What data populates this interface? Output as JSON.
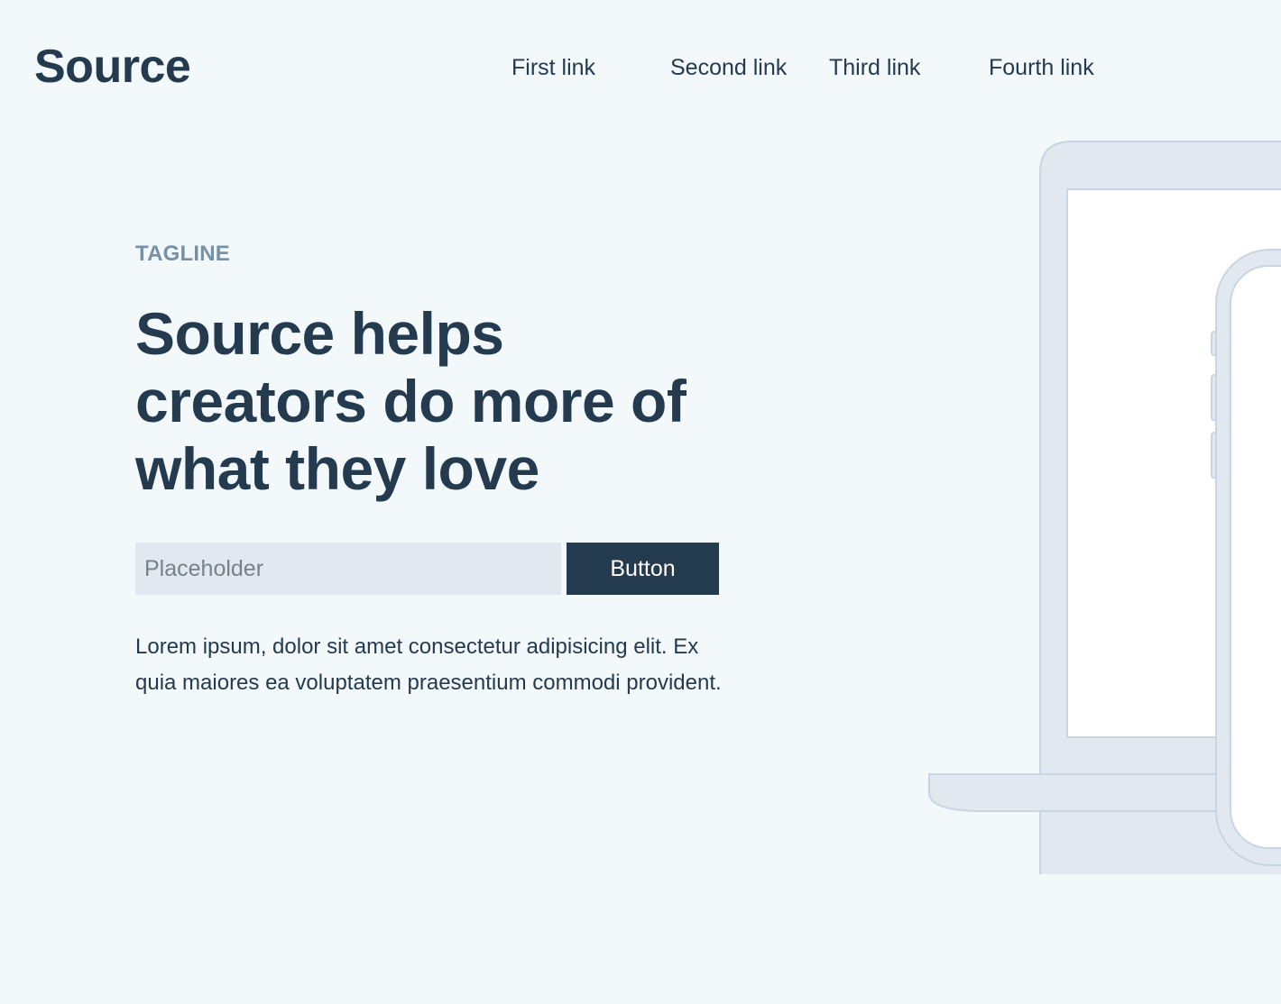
{
  "header": {
    "logo": "Source",
    "nav": [
      {
        "label": "First link"
      },
      {
        "label": "Second link"
      },
      {
        "label": "Third link"
      },
      {
        "label": "Fourth link"
      }
    ]
  },
  "hero": {
    "tagline": "TAGLINE",
    "headline": "Source helps creators do more of what they love",
    "input": {
      "placeholder": "Placeholder",
      "value": ""
    },
    "button_label": "Button",
    "body": "Lorem ipsum, dolor sit amet consectetur adipisicing elit. Ex quia maiores ea voluptatem praesentium commodi provident."
  },
  "illustration": {
    "devices": [
      "laptop",
      "phone"
    ]
  },
  "colors": {
    "background": "#f3f8fb",
    "text": "#243a4f",
    "tagline": "#7690a6",
    "input_background": "#e1e8f0",
    "button_background": "#243a4f",
    "button_text": "#ffffff",
    "device_fill": "#e1e8f0",
    "device_stroke": "#c9d5e0",
    "screen": "#ffffff"
  }
}
